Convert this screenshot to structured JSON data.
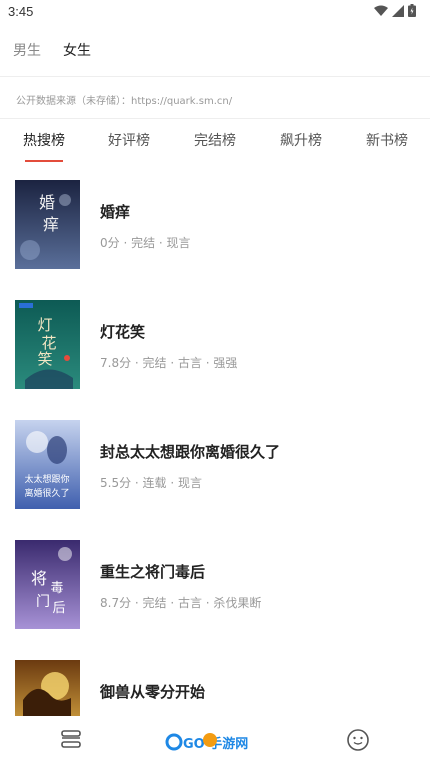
{
  "status_bar": {
    "time": "3:45"
  },
  "gender_tabs": [
    {
      "label": "男生",
      "active": false
    },
    {
      "label": "女生",
      "active": true
    }
  ],
  "source_line": "公开数据来源（未存储）：https://quark.sm.cn/",
  "rank_tabs": [
    {
      "label": "热搜榜",
      "active": true
    },
    {
      "label": "好评榜",
      "active": false
    },
    {
      "label": "完结榜",
      "active": false
    },
    {
      "label": "飙升榜",
      "active": false
    },
    {
      "label": "新书榜",
      "active": false
    }
  ],
  "books": [
    {
      "title": "婚痒",
      "meta": "0分 · 完结 · 现言",
      "cover_text": "婚痒",
      "cover_colors": [
        "#1b2340",
        "#5a6f9a"
      ]
    },
    {
      "title": "灯花笑",
      "meta": "7.8分 · 完结 · 古言 · 强强",
      "cover_text": "灯花笑",
      "cover_colors": [
        "#0d5a54",
        "#c9a24a"
      ]
    },
    {
      "title": "封总太太想跟你离婚很久了",
      "meta": "5.5分 · 连载 · 现言",
      "cover_text": "太太想跟你离婚很久了",
      "cover_colors": [
        "#3f5fae",
        "#c6d3ee"
      ]
    },
    {
      "title": "重生之将门毒后",
      "meta": "8.7分 · 完结 · 古言 · 杀伐果断",
      "cover_text": "将门毒后",
      "cover_colors": [
        "#3a2a6e",
        "#a792d6"
      ]
    },
    {
      "title": "御兽从零分开始",
      "meta": "",
      "cover_text": "",
      "cover_colors": [
        "#6b3a10",
        "#f2c14e"
      ]
    }
  ],
  "bottom_nav": {
    "watermark": "GO 手游网",
    "icons": [
      "layers-icon",
      "smiley-icon"
    ]
  }
}
